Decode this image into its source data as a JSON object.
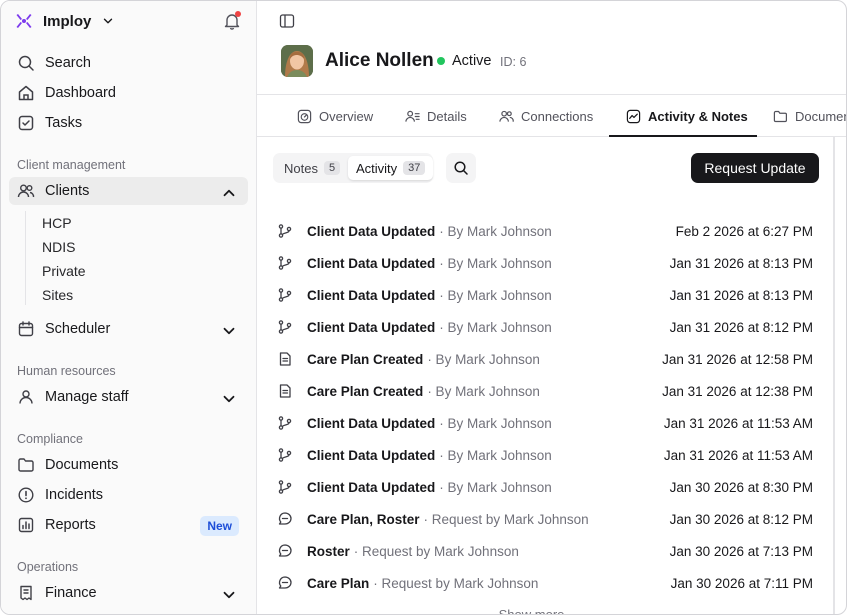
{
  "sidebar": {
    "brand": "Imploy",
    "nav_top": [
      {
        "label": "Search",
        "icon": "search-icon"
      },
      {
        "label": "Dashboard",
        "icon": "home-icon"
      },
      {
        "label": "Tasks",
        "icon": "checkbox-icon"
      }
    ],
    "sections": {
      "client_management": "Client management",
      "human_resources": "Human resources",
      "compliance": "Compliance",
      "operations": "Operations"
    },
    "clients_label": "Clients",
    "clients_sub": [
      "HCP",
      "NDIS",
      "Private",
      "Sites"
    ],
    "scheduler_label": "Scheduler",
    "manage_staff_label": "Manage staff",
    "documents_label": "Documents",
    "incidents_label": "Incidents",
    "reports_label": "Reports",
    "reports_badge": "New",
    "finance_label": "Finance",
    "accent_color": "#7c3aed",
    "notification_dot_color": "#ef4444"
  },
  "header": {
    "name": "Alice Nollen",
    "status": "Active",
    "id_label": "ID: 6",
    "status_color": "#22c55e"
  },
  "tabs": [
    {
      "label": "Overview"
    },
    {
      "label": "Details"
    },
    {
      "label": "Connections"
    },
    {
      "label": "Activity & Notes",
      "active": true
    },
    {
      "label": "Documents"
    }
  ],
  "toolbar": {
    "notes_label": "Notes",
    "notes_count": "5",
    "activity_label": "Activity",
    "activity_count": "37",
    "request_update_label": "Request Update"
  },
  "activity": [
    {
      "title": "Client Data Updated",
      "meta": "· By Mark Johnson",
      "date": "Feb 2 2026 at 6:27 PM",
      "icon": "git-branch-icon"
    },
    {
      "title": "Client Data Updated",
      "meta": "· By Mark Johnson",
      "date": "Jan 31 2026 at 8:13 PM",
      "icon": "git-branch-icon"
    },
    {
      "title": "Client Data Updated",
      "meta": "· By Mark Johnson",
      "date": "Jan 31 2026 at 8:13 PM",
      "icon": "git-branch-icon"
    },
    {
      "title": "Client Data Updated",
      "meta": "· By Mark Johnson",
      "date": "Jan 31 2026 at 8:12 PM",
      "icon": "git-branch-icon"
    },
    {
      "title": "Care Plan Created",
      "meta": "· By Mark Johnson",
      "date": "Jan 31 2026 at 12:58 PM",
      "icon": "file-icon"
    },
    {
      "title": "Care Plan Created",
      "meta": "· By Mark Johnson",
      "date": "Jan 31 2026 at 12:38 PM",
      "icon": "file-icon"
    },
    {
      "title": "Client Data Updated",
      "meta": "· By Mark Johnson",
      "date": "Jan 31 2026 at 11:53 AM",
      "icon": "git-branch-icon"
    },
    {
      "title": "Client Data Updated",
      "meta": "· By Mark Johnson",
      "date": "Jan 31 2026 at 11:53 AM",
      "icon": "git-branch-icon"
    },
    {
      "title": "Client Data Updated",
      "meta": "· By Mark Johnson",
      "date": "Jan 30 2026 at 8:30 PM",
      "icon": "git-branch-icon"
    },
    {
      "title": "Care Plan, Roster",
      "meta": "· Request by Mark Johnson",
      "date": "Jan 30 2026 at 8:12 PM",
      "icon": "message-icon"
    },
    {
      "title": "Roster",
      "meta": "· Request by Mark Johnson",
      "date": "Jan 30 2026 at 7:13 PM",
      "icon": "message-icon"
    },
    {
      "title": "Care Plan",
      "meta": "· Request by Mark Johnson",
      "date": "Jan 30 2026 at 7:11 PM",
      "icon": "message-icon"
    }
  ],
  "show_more_label": "Show more"
}
